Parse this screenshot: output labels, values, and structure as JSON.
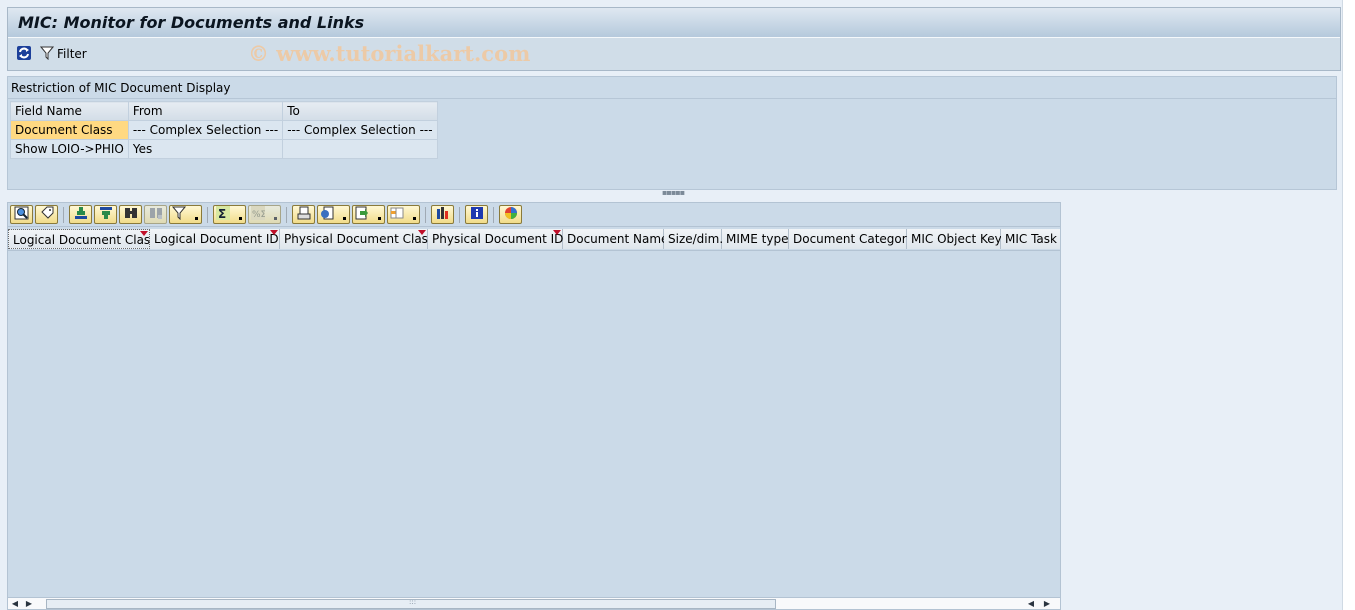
{
  "window": {
    "title": "MIC: Monitor for Documents and Links",
    "watermark": "© www.tutorialkart.com"
  },
  "app_toolbar": {
    "refresh_icon": "refresh-icon",
    "filter_label": "Filter",
    "filter_icon": "filter-funnel-icon"
  },
  "restriction": {
    "caption": "Restriction of MIC Document Display",
    "headers": [
      "Field Name",
      "From",
      "To"
    ],
    "rows": [
      {
        "field": "Document Class",
        "from": "--- Complex Selection ---",
        "to": "--- Complex Selection ---",
        "highlighted": true
      },
      {
        "field": "Show LOIO->PHIO",
        "from": "Yes",
        "to": ""
      }
    ]
  },
  "alv": {
    "toolbar_icons": [
      "details-icon",
      "tag-icon",
      "sort-ascending-icon",
      "sort-descending-icon",
      "find-icon",
      "find-next-icon",
      "filter-icon",
      "sum-icon",
      "subtotal-icon",
      "print-icon",
      "view-icon",
      "export-icon",
      "layout-icon",
      "graphics-icon",
      "info-icon",
      "abc-analysis-icon"
    ],
    "columns": [
      {
        "label": "Logical Document Class",
        "sorted": true
      },
      {
        "label": "Logical Document ID",
        "sorted": true
      },
      {
        "label": "Physical Document Class",
        "sorted": true
      },
      {
        "label": "Physical Document ID",
        "sorted": true
      },
      {
        "label": "Document Name",
        "sorted": false
      },
      {
        "label": "Size/dim.",
        "sorted": false
      },
      {
        "label": "MIME type",
        "sorted": false
      },
      {
        "label": "Document Category",
        "sorted": false
      },
      {
        "label": "MIC Object Key",
        "sorted": false
      },
      {
        "label": "MIC Task ID",
        "sorted": false
      }
    ],
    "rows": []
  },
  "colors": {
    "title_text": "#0b1520",
    "highlight": "#ffd982",
    "sort_marker": "#c0102a",
    "panel": "#cbdae8"
  }
}
